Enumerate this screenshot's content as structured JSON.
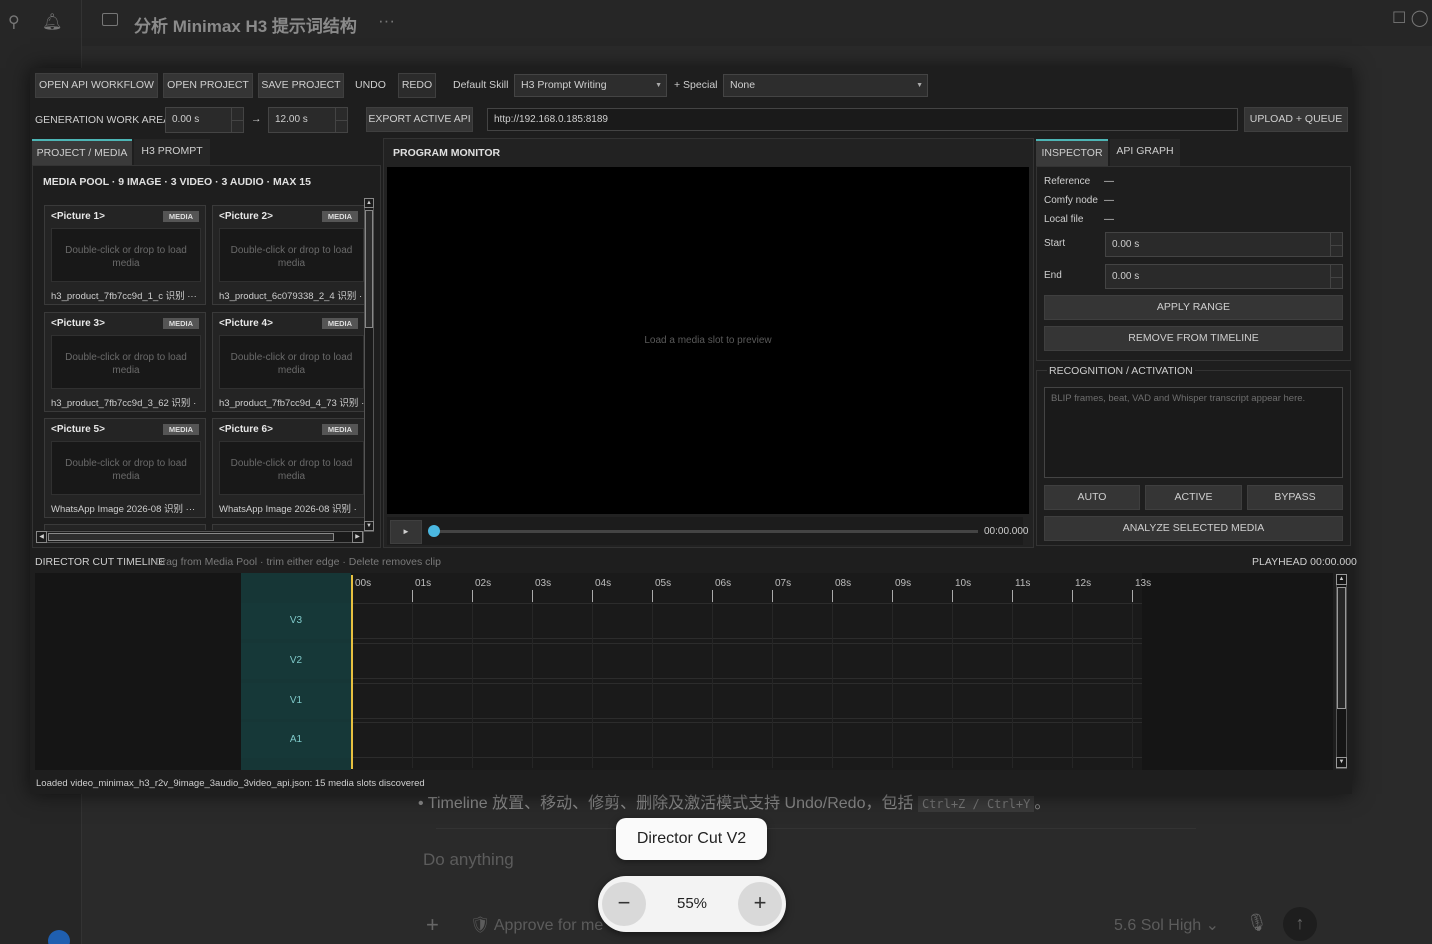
{
  "host": {
    "title": "分析 Minimax H3 提示词结构",
    "more": "···",
    "bullet_text": "Timeline 放置、移动、修剪、删除及激活模式支持 Undo/Redo，包括",
    "bullet_code": "Ctrl+Z / Ctrl+Y",
    "bullet_end": "。",
    "placeholder": "Do anything",
    "approve": "Approve for me",
    "model": "5.6 Sol  High",
    "plus": "+"
  },
  "toolbar": {
    "open_api_workflow": "OPEN API WORKFLOW",
    "open_project": "OPEN PROJECT",
    "save_project": "SAVE PROJECT",
    "undo": "UNDO",
    "redo": "REDO",
    "default_skill_label": "Default Skill",
    "default_skill_value": "H3 Prompt Writing",
    "special_label": "+ Special",
    "special_value": "None"
  },
  "work_area": {
    "label": "GENERATION WORK AREA",
    "start": "0.00 s",
    "arrow": "→",
    "end": "12.00 s",
    "export_btn": "EXPORT ACTIVE API",
    "url": "http://192.168.0.185:8189",
    "upload_btn": "UPLOAD + QUEUE"
  },
  "left_panel": {
    "tabs": [
      "PROJECT / MEDIA",
      "H3 PROMPT"
    ],
    "pool_title": "MEDIA POOL · 9 IMAGE · 3 VIDEO · 3 AUDIO · MAX 15",
    "cards": [
      {
        "title": "<Picture 1>",
        "badge": "MEDIA",
        "drop": "Double-click or drop to load media",
        "file": "h3_product_7fb7cc9d_1_c 识别 ···"
      },
      {
        "title": "<Picture 2>",
        "badge": "MEDIA",
        "drop": "Double-click or drop to load media",
        "file": "h3_product_6c079338_2_4 识别 ·"
      },
      {
        "title": "<Picture 3>",
        "badge": "MEDIA",
        "drop": "Double-click or drop to load media",
        "file": "h3_product_7fb7cc9d_3_62 识别 ·"
      },
      {
        "title": "<Picture 4>",
        "badge": "MEDIA",
        "drop": "Double-click or drop to load media",
        "file": "h3_product_7fb7cc9d_4_73 识别 ·"
      },
      {
        "title": "<Picture 5>",
        "badge": "MEDIA",
        "drop": "Double-click or drop to load media",
        "file": "WhatsApp Image 2026-08 识别 ···"
      },
      {
        "title": "<Picture 6>",
        "badge": "MEDIA",
        "drop": "Double-click or drop to load media",
        "file": "WhatsApp Image 2026-08 识别 ·"
      }
    ]
  },
  "monitor": {
    "title": "PROGRAM MONITOR",
    "placeholder": "Load a media slot to preview",
    "time": "00:00.000",
    "playback_progress": 0
  },
  "inspector": {
    "tabs": [
      "INSPECTOR",
      "API GRAPH"
    ],
    "reference_label": "Reference",
    "reference_value": "—",
    "comfy_label": "Comfy node",
    "comfy_value": "—",
    "local_label": "Local file",
    "local_value": "—",
    "start_label": "Start",
    "start_value": "0.00 s",
    "end_label": "End",
    "end_value": "0.00 s",
    "apply_range": "APPLY RANGE",
    "remove": "REMOVE FROM TIMELINE",
    "recog_title": "RECOGNITION / ACTIVATION",
    "recog_placeholder": "BLIP frames, beat, VAD and Whisper transcript appear here.",
    "auto": "AUTO",
    "active": "ACTIVE",
    "bypass": "BYPASS",
    "analyze": "ANALYZE SELECTED MEDIA"
  },
  "timeline": {
    "title": "DIRECTOR CUT TIMELINE",
    "hint": "Drag from Media Pool · trim either edge · Delete removes clip",
    "playhead": "PLAYHEAD 00:00.000",
    "ticks": [
      "00s",
      "01s",
      "02s",
      "03s",
      "04s",
      "05s",
      "06s",
      "07s",
      "08s",
      "09s",
      "10s",
      "11s",
      "12s",
      "13s"
    ],
    "tracks": [
      "V3",
      "V2",
      "V1",
      "A1"
    ]
  },
  "status": "Loaded video_minimax_h3_r2v_9image_3audio_3video_api.json: 15 media slots discovered",
  "overlay": {
    "pill": "Director Cut V2",
    "zoom_minus": "−",
    "zoom_value": "55%",
    "zoom_plus": "+"
  }
}
